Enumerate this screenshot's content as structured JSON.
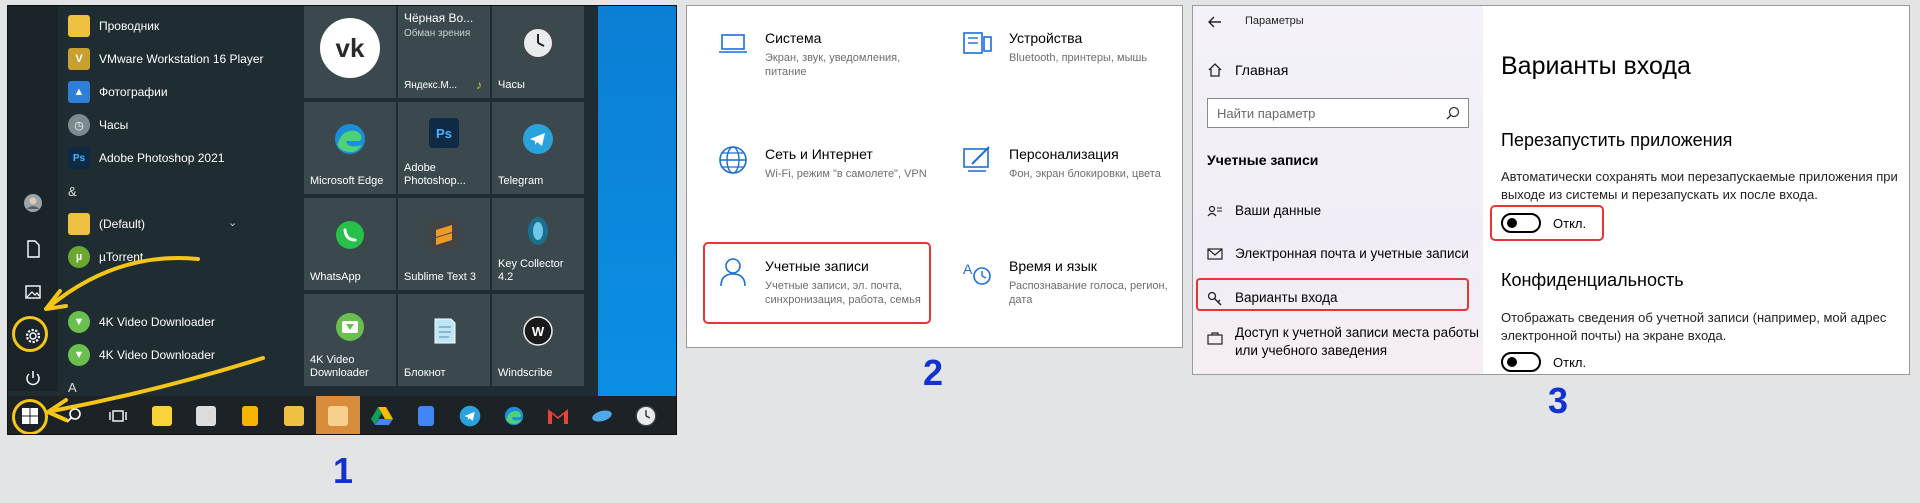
{
  "panel1": {
    "apps": [
      {
        "label": "Проводник",
        "icon": "folder-icon",
        "color": "#f0c040"
      },
      {
        "label": "VMware Workstation 16 Player",
        "icon": "vmware-icon",
        "color": "#c8a030"
      },
      {
        "label": "Фотографии",
        "icon": "photos-icon",
        "color": "#2f7fd8"
      },
      {
        "label": "Часы",
        "icon": "clock-icon",
        "color": "#7d8a90"
      },
      {
        "label": "Adobe Photoshop 2021",
        "icon": "photoshop-icon",
        "color": "#0f2a44"
      },
      {
        "label": "&",
        "icon": "",
        "color": ""
      },
      {
        "label": "(Default)",
        "icon": "folder-icon",
        "color": "#f0c040"
      },
      {
        "label": "µTorrent",
        "icon": "utorrent-icon",
        "color": "#6aa830"
      },
      {
        "label": "4K Video Downloader",
        "icon": "4k-icon",
        "color": "#6bbf4e"
      },
      {
        "label": "4K Video Downloader",
        "icon": "4k-icon",
        "color": "#6bbf4e"
      },
      {
        "label": "A",
        "icon": "",
        "color": ""
      }
    ],
    "tiles": [
      {
        "label": "",
        "top": "Чёрная Во...",
        "sub1": "Яндекс.Музыка",
        "sub2": "Обман зрения",
        "small": "Яндекс.М...",
        "icon": "vk-icon"
      },
      {
        "label": "Часы",
        "icon": "clock-icon"
      },
      {
        "label": "Microsoft Edge",
        "icon": "edge-icon"
      },
      {
        "label": "Adobe Photoshop...",
        "icon": "photoshop-icon"
      },
      {
        "label": "Telegram",
        "icon": "telegram-icon"
      },
      {
        "label": "WhatsApp",
        "icon": "whatsapp-icon"
      },
      {
        "label": "Sublime Text 3",
        "icon": "sublime-icon"
      },
      {
        "label": "Key Collector 4.2",
        "icon": "keycollector-icon"
      },
      {
        "label": "4K Video Downloader",
        "icon": "4k-icon"
      },
      {
        "label": "Блокнот",
        "icon": "notepad-icon"
      },
      {
        "label": "Windscribe",
        "icon": "windscribe-icon"
      }
    ],
    "step": "1"
  },
  "panel2": {
    "items": [
      {
        "title": "Система",
        "desc": "Экран, звук, уведомления, питание",
        "icon": "laptop-icon"
      },
      {
        "title": "Устройства",
        "desc": "Bluetooth, принтеры, мышь",
        "icon": "devices-icon"
      },
      {
        "title": "Сеть и Интернет",
        "desc": "Wi-Fi, режим \"в самолете\", VPN",
        "icon": "globe-icon"
      },
      {
        "title": "Персонализация",
        "desc": "Фон, экран блокировки, цвета",
        "icon": "paint-icon"
      },
      {
        "title": "Учетные записи",
        "desc": "Учетные записи, эл. почта, синхронизация, работа, семья",
        "icon": "user-icon"
      },
      {
        "title": "Время и язык",
        "desc": "Распознавание голоса, регион, дата",
        "icon": "time-language-icon"
      }
    ],
    "step": "2"
  },
  "panel3": {
    "window_title": "Параметры",
    "home": "Главная",
    "search_placeholder": "Найти параметр",
    "section": "Учетные записи",
    "nav": [
      {
        "label": "Ваши данные",
        "icon": "person-card-icon"
      },
      {
        "label": "Электронная почта и учетные записи",
        "icon": "mail-icon"
      },
      {
        "label": "Варианты входа",
        "icon": "key-icon"
      },
      {
        "label": "Доступ к учетной записи места работы или учебного заведения",
        "icon": "briefcase-icon"
      }
    ],
    "heading": "Варианты входа",
    "restart_title": "Перезапустить приложения",
    "restart_desc": "Автоматически сохранять мои перезапускаемые приложения при выходе из системы и перезапускать их после входа.",
    "toggle1_label": "Откл.",
    "privacy_title": "Конфиденциальность",
    "privacy_desc": "Отображать сведения об учетной записи (например, мой адрес электронной почты) на экране входа.",
    "toggle2_label": "Откл.",
    "toggle1_on": false,
    "toggle2_on": false,
    "step": "3"
  },
  "colors": {
    "highlight_red": "#e53535",
    "annotation_yellow": "#f5c518",
    "step_blue": "#1231cf"
  }
}
